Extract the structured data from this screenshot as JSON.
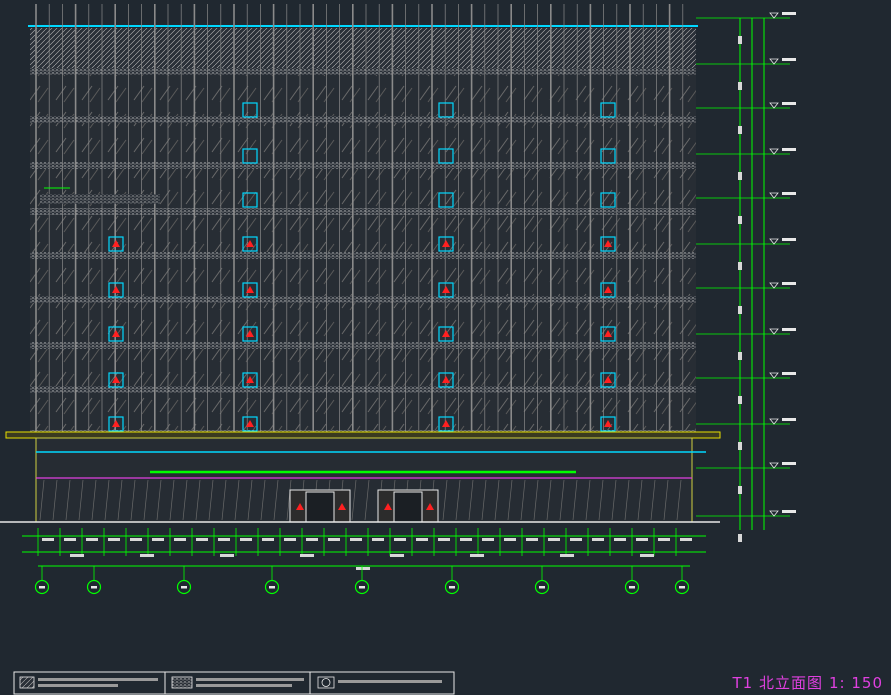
{
  "drawing": {
    "title": "T1 北立面图",
    "scale": "1: 150"
  },
  "elevation_levels": [
    "",
    "",
    "",
    "",
    "",
    "",
    "",
    "",
    "",
    "",
    "",
    ""
  ],
  "floors": 9,
  "grid_axes": 9,
  "legend": {
    "items": [
      {
        "swatch": "hatched-box",
        "text": ""
      },
      {
        "swatch": "dotted-box",
        "text": ""
      },
      {
        "swatch": "circle-box",
        "text": ""
      }
    ]
  },
  "colors": {
    "background": "#202830",
    "cad_green": "#00ff00",
    "cad_cyan": "#00d8ff",
    "cad_magenta": "#e040e0",
    "cad_yellow": "#e8e000",
    "cad_red": "#ff2020",
    "cad_white": "#e8e8e8",
    "cad_gray": "#8a8a8a"
  }
}
